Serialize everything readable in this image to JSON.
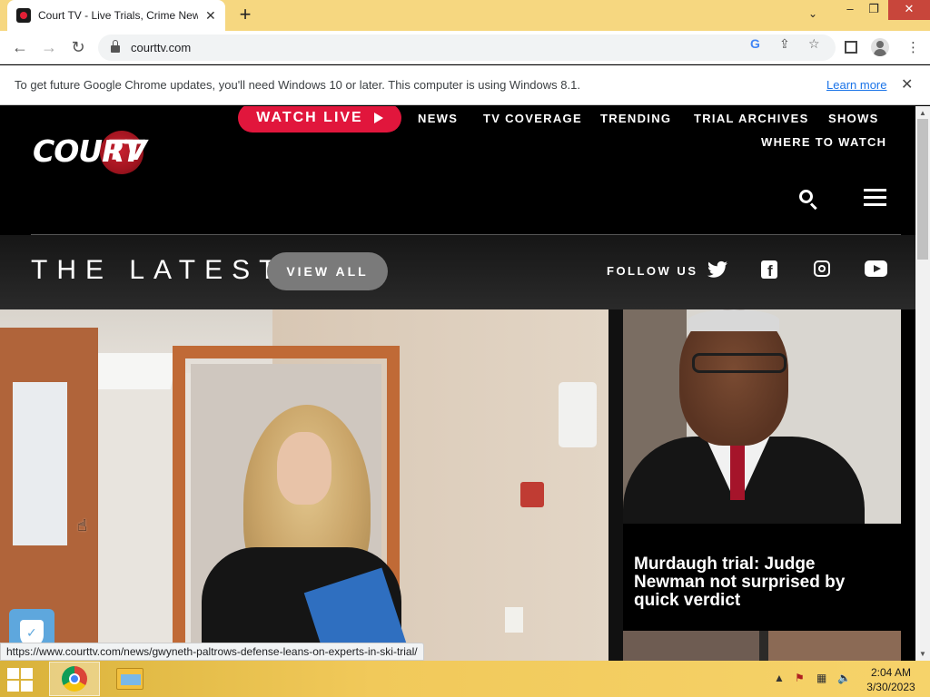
{
  "browser": {
    "tab_title": "Court TV - Live Trials, Crime New",
    "tab_close": "✕",
    "new_tab": "+",
    "url": "courttv.com",
    "infobar": {
      "message": "To get future Google Chrome updates, you'll need Windows 10 or later. This computer is using Windows 8.1.",
      "link": "Learn more",
      "close": "✕"
    },
    "status_url": "https://www.courttv.com/news/gwyneth-paltrows-defense-leans-on-experts-in-ski-trial/"
  },
  "site": {
    "logo_court": "COURT",
    "logo_tv": "TV",
    "watch_live": "WATCH LIVE",
    "nav": {
      "news": "NEWS",
      "tv_coverage": "TV COVERAGE",
      "trending": "TRENDING",
      "trial_archives": "TRIAL ARCHIVES",
      "shows": "SHOWS",
      "where_to_watch": "WHERE TO WATCH"
    },
    "latest_title": "THE LATEST",
    "view_all": "VIEW ALL",
    "follow_us": "FOLLOW US",
    "social_icons": [
      "twitter-icon",
      "facebook-icon",
      "instagram-icon",
      "youtube-icon"
    ],
    "side_story_title": "Murdaugh trial: Judge Newman not surprised by quick verdict",
    "accent_color": "#e1163c"
  },
  "taskbar": {
    "time": "2:04 AM",
    "date": "3/30/2023"
  }
}
